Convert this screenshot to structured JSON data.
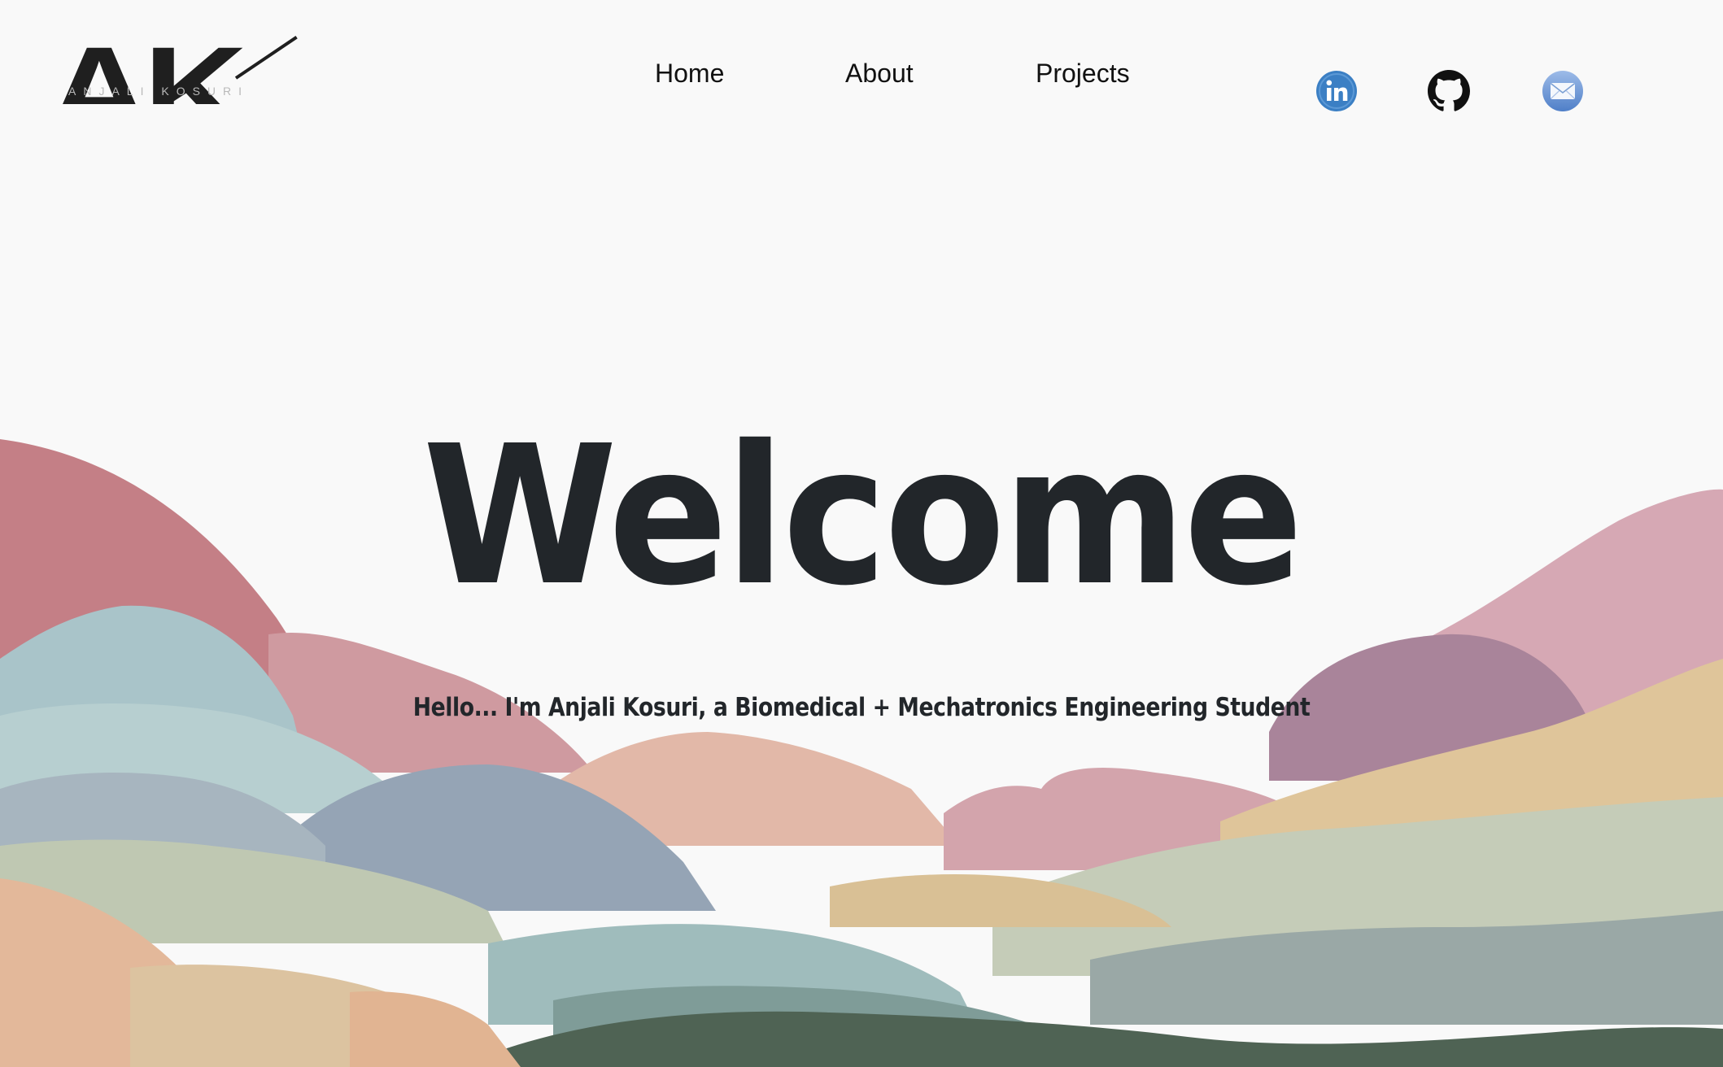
{
  "logo": {
    "letters": "AK",
    "subtitle": "ANJALI KOSURI"
  },
  "nav": {
    "items": [
      {
        "label": "Home"
      },
      {
        "label": "About"
      },
      {
        "label": "Projects"
      }
    ]
  },
  "social": {
    "items": [
      {
        "icon": "linkedin-icon",
        "color": "#3b7fc4"
      },
      {
        "icon": "github-icon",
        "color": "#111111"
      },
      {
        "icon": "mail-icon",
        "color": "#6b97d8"
      }
    ]
  },
  "hero": {
    "title": "Welcome",
    "subtitle": "Hello... I'm Anjali Kosuri, a Biomedical + Mechatronics Engineering Student"
  },
  "colors": {
    "background": "#f9f9f9",
    "text": "#22262a",
    "hill_rose": "#c47f86",
    "hill_pink": "#d6a4ad",
    "hill_mauve": "#a9849a",
    "hill_sky": "#a9c4c9",
    "hill_slate": "#95a4b5",
    "hill_sage": "#bfc8b2",
    "hill_sand": "#dfc59a",
    "hill_peach": "#e2b59c",
    "hill_forest": "#4f6354"
  }
}
